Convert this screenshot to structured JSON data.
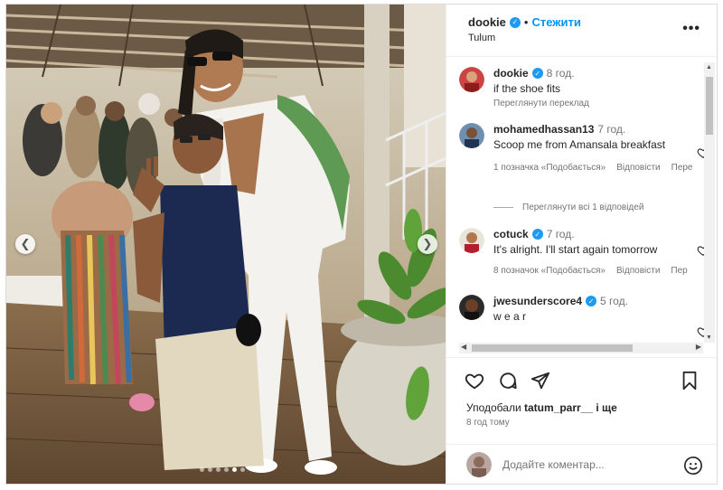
{
  "post": {
    "author": "dookie",
    "follow_label": "Стежити",
    "bullet": "•",
    "location": "Tulum",
    "more_icon": "more-horizontal-icon"
  },
  "caption": {
    "author": "dookie",
    "time": "8 год.",
    "text": "if the shoe fits",
    "translate_label": "Переглянути переклад"
  },
  "comments": [
    {
      "author": "mohamedhassan13",
      "time": "7 год.",
      "text": "Scoop me from Amansala breakfast",
      "likes": "1 позначка «Подобається»",
      "reply": "Відповісти",
      "more": "Пере",
      "view_replies": "Переглянути всі 1 відповідей"
    },
    {
      "author": "cotuck",
      "verified": true,
      "time": "7 год.",
      "text": "It's alright. I'll start again tomorrow",
      "likes": "8 позначок «Подобається»",
      "reply": "Відповісти",
      "more": "Пер"
    },
    {
      "author": "jwesunderscore4",
      "verified": true,
      "time": "5 год.",
      "text": "w e a r"
    }
  ],
  "likes_row": {
    "prefix": "Уподобали",
    "user": "tatum_parr__",
    "suffix": "і ще"
  },
  "posted_ago": "8 год тому",
  "comment_input": {
    "placeholder": "Додайте коментар..."
  },
  "icons": [
    "heart-icon",
    "comment-icon",
    "share-icon",
    "bookmark-icon",
    "emoji-icon",
    "verified-icon"
  ],
  "colors": {
    "link_blue": "#0095f6",
    "verified_blue": "#1d9bf0",
    "text": "#262626",
    "muted": "#737373"
  },
  "carousel": {
    "slides": 6,
    "active_index": 4
  }
}
